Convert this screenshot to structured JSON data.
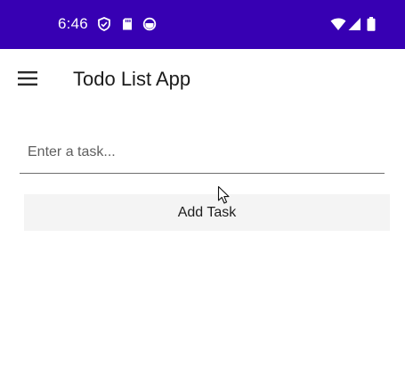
{
  "status_bar": {
    "time": "6:46",
    "left_icons": [
      "shield-icon",
      "sd-card-icon",
      "sync-icon"
    ],
    "right_icons": [
      "wifi-icon",
      "signal-icon",
      "battery-icon"
    ],
    "background_color": "#3700b3"
  },
  "app_bar": {
    "title": "Todo List App",
    "menu_icon": "hamburger-menu-icon"
  },
  "task_input": {
    "value": "",
    "placeholder": "Enter a task..."
  },
  "add_button": {
    "label": "Add Task"
  }
}
